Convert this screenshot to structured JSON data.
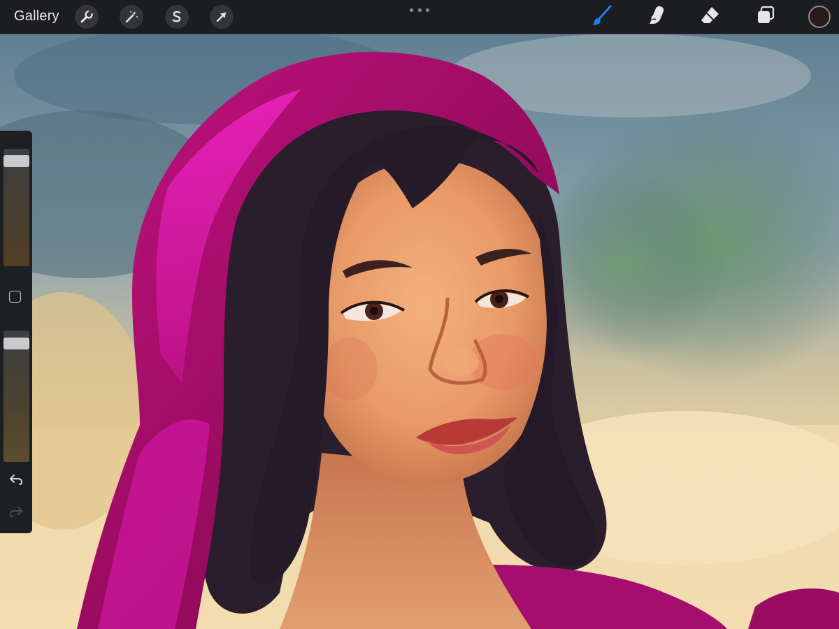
{
  "toolbar": {
    "gallery_label": "Gallery",
    "left_tools": [
      {
        "name": "actions",
        "icon": "wrench-icon"
      },
      {
        "name": "adjustments",
        "icon": "magic-wand-icon"
      },
      {
        "name": "selection",
        "icon": "selection-s-icon"
      },
      {
        "name": "transform",
        "icon": "arrow-cursor-icon"
      }
    ],
    "more_icon": "more-dots-icon",
    "right_tools": [
      {
        "name": "brush",
        "icon": "brush-icon",
        "active": true
      },
      {
        "name": "smudge",
        "icon": "smudge-finger-icon",
        "active": false
      },
      {
        "name": "eraser",
        "icon": "eraser-icon",
        "active": false
      },
      {
        "name": "layers",
        "icon": "layers-icon",
        "active": false
      }
    ],
    "current_color": "#2a1a1c",
    "active_tool_color": "#1f7df2"
  },
  "sidebar": {
    "brush_size": 0.05,
    "brush_opacity": 0.05,
    "modify_icon": "square-modify-icon",
    "undo_icon": "undo-arrow-icon",
    "redo_icon": "redo-arrow-icon",
    "redo_enabled": false
  },
  "canvas": {
    "artwork": "painted-portrait"
  }
}
